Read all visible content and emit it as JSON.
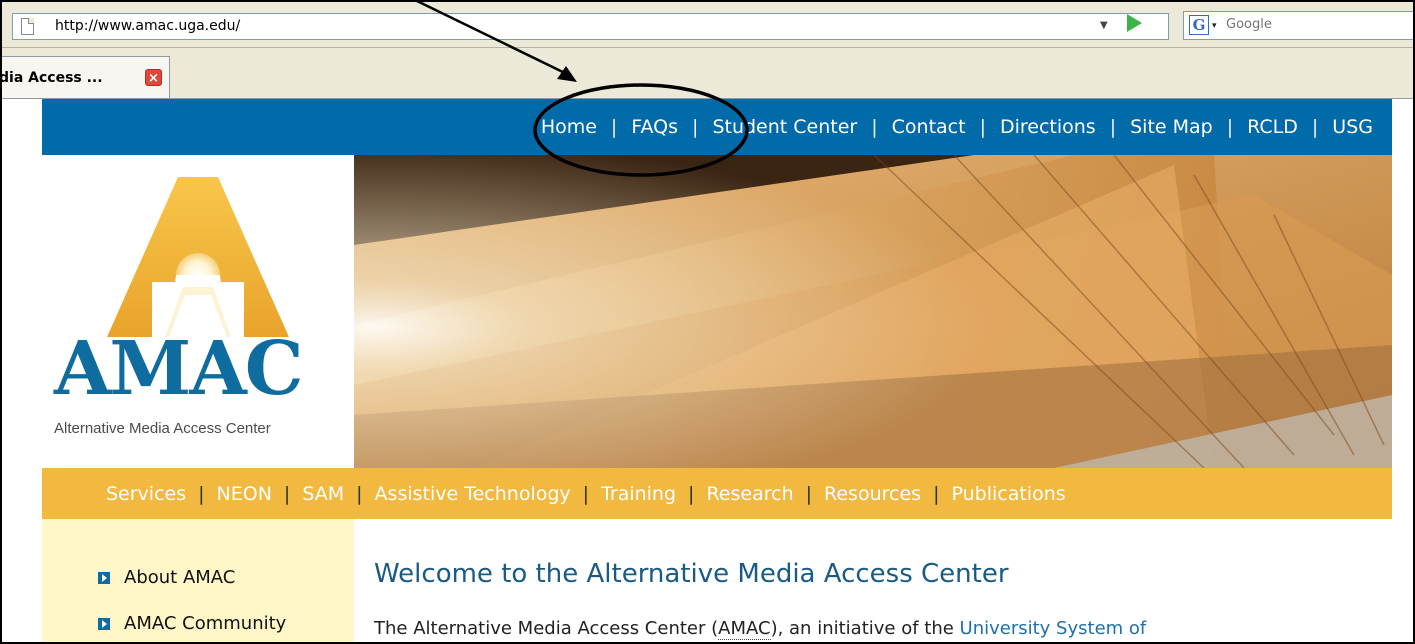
{
  "browser": {
    "url": "http://www.amac.uga.edu/",
    "search_placeholder": "Google",
    "tab_title": "dia Access ...",
    "tab_close_glyph": "×",
    "url_dropdown_glyph": "▼",
    "search_engine_glyph": "G",
    "search_dropdown_glyph": "▾"
  },
  "top_nav": {
    "items": [
      "Home",
      "FAQs",
      "Student Center",
      "Contact",
      "Directions",
      "Site Map",
      "RCLD",
      "USG"
    ],
    "separator": "|",
    "highlighted": "Student Center"
  },
  "logo": {
    "name": "AMAC",
    "subtitle": "Alternative Media Access Center"
  },
  "sub_nav": {
    "items": [
      "Services",
      "NEON",
      "SAM",
      "Assistive Technology",
      "Training",
      "Research",
      "Resources",
      "Publications"
    ],
    "separator": "|"
  },
  "sidebar": {
    "items": [
      "About AMAC",
      "AMAC Community"
    ]
  },
  "main": {
    "heading": "Welcome to the Alternative Media Access Center",
    "intro_start": "The Alternative Media Access Center (",
    "intro_abbr": "AMAC",
    "intro_mid": "), an initiative of the ",
    "intro_link": "University System of"
  },
  "colors": {
    "top_nav_bg": "#006ba8",
    "sub_nav_bg": "#f2b940",
    "sidebar_bg": "#fff7c7",
    "logo_blue": "#0f6c9f",
    "heading_blue": "#1a5b86",
    "link_blue": "#1f6fae"
  }
}
